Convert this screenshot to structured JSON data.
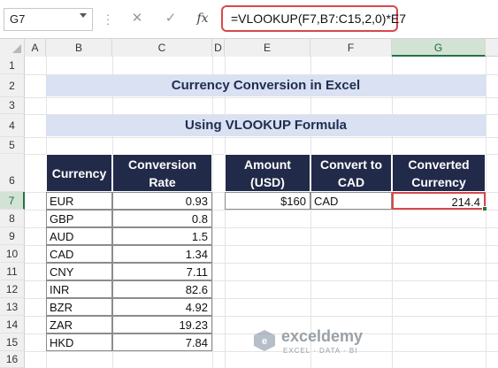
{
  "formula_bar": {
    "name_box": "G7",
    "cancel_glyph": "✕",
    "enter_glyph": "✓",
    "fx_glyph": "fx",
    "formula": "=VLOOKUP(F7,B7:C15,2,0)*E7"
  },
  "columns": [
    "A",
    "B",
    "C",
    "D",
    "E",
    "F",
    "G"
  ],
  "rows": [
    "1",
    "2",
    "3",
    "4",
    "5",
    "6",
    "7",
    "8",
    "9",
    "10",
    "11",
    "12",
    "13",
    "14",
    "15",
    "16"
  ],
  "selected_cell": "G7",
  "title": "Currency Conversion in Excel",
  "subtitle": "Using VLOOKUP Formula",
  "rates_table": {
    "header_currency": "Currency",
    "header_rate_line1": "Conversion",
    "header_rate_line2": "Rate",
    "rows": [
      {
        "currency": "EUR",
        "rate": "0.93"
      },
      {
        "currency": "GBP",
        "rate": "0.8"
      },
      {
        "currency": "AUD",
        "rate": "1.5"
      },
      {
        "currency": "CAD",
        "rate": "1.34"
      },
      {
        "currency": "CNY",
        "rate": "7.11"
      },
      {
        "currency": "INR",
        "rate": "82.6"
      },
      {
        "currency": "BZR",
        "rate": "4.92"
      },
      {
        "currency": "ZAR",
        "rate": "19.23"
      },
      {
        "currency": "HKD",
        "rate": "7.84"
      }
    ]
  },
  "conversion_table": {
    "header_amount_line1": "Amount",
    "header_amount_line2": "(USD)",
    "header_convert_line1": "Convert to",
    "header_convert_line2": "CAD",
    "header_converted_line1": "Converted",
    "header_converted_line2": "Currency",
    "amount": "$160",
    "convert_to": "CAD",
    "converted": "214.4"
  },
  "watermark": {
    "name": "exceldemy",
    "tagline": "EXCEL · DATA · BI"
  },
  "colors": {
    "banner_bg": "#d9e1f2",
    "header_bg": "#222a4a",
    "selection_red": "#d9474a",
    "excel_green": "#217346"
  }
}
